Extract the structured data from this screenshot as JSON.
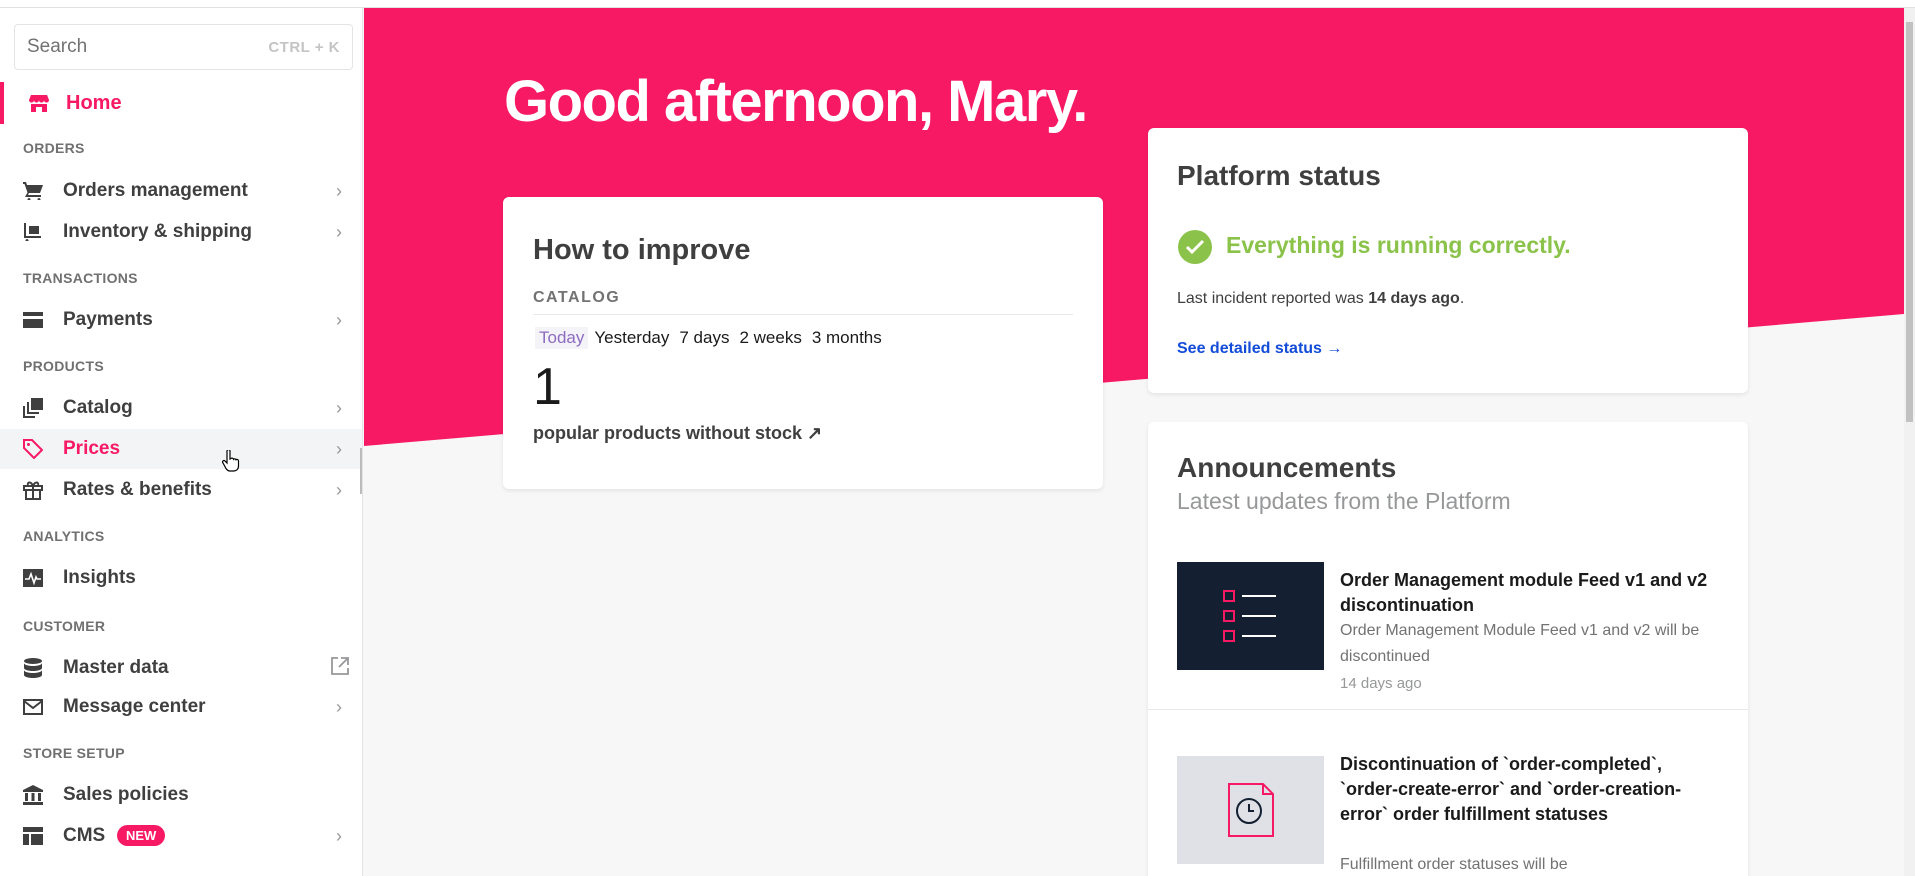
{
  "colors": {
    "brand": "#f71963",
    "success": "#8bc34a",
    "link": "#134cd8"
  },
  "search": {
    "placeholder": "Search",
    "shortcut": "CTRL + K"
  },
  "sidebar": {
    "home": {
      "label": "Home",
      "icon": "store-icon"
    },
    "sections": {
      "orders": "ORDERS",
      "transactions": "TRANSACTIONS",
      "products": "PRODUCTS",
      "analytics": "ANALYTICS",
      "customer": "CUSTOMER",
      "store_setup": "STORE SETUP"
    },
    "items": {
      "orders_management": "Orders management",
      "inventory_shipping": "Inventory & shipping",
      "payments": "Payments",
      "catalog": "Catalog",
      "prices": "Prices",
      "rates_benefits": "Rates & benefits",
      "insights": "Insights",
      "master_data": "Master data",
      "message_center": "Message center",
      "sales_policies": "Sales policies",
      "cms": "CMS"
    },
    "cms_badge": "NEW",
    "active_item": "Prices"
  },
  "main": {
    "greeting_prefix": "Good afternoon, ",
    "user_name": "Mary",
    "greeting_suffix": ".",
    "improve": {
      "title": "How to improve",
      "section": "CATALOG",
      "periods": [
        "Today",
        "Yesterday",
        "7 days",
        "2 weeks",
        "3 months"
      ],
      "selected_period": "Today",
      "count": "1",
      "count_label": "popular products without stock ↗"
    },
    "status": {
      "title": "Platform status",
      "message": "Everything is running correctly.",
      "incident_prefix": "Last incident reported was ",
      "incident_time": "14 days ago",
      "incident_suffix": ".",
      "link": "See detailed status →"
    },
    "announcements": {
      "title": "Announcements",
      "subtitle": "Latest updates from the Platform",
      "items": [
        {
          "title": "Order Management module Feed v1 and v2 discontinuation",
          "description": "Order Management Module Feed v1 and v2 will be discontinued",
          "date": "14 days ago"
        },
        {
          "title": "Discontinuation of `order-completed`, `order-create-error` and `order-creation-error` order fulfillment statuses",
          "description": "Fulfillment order statuses will be"
        }
      ]
    }
  }
}
